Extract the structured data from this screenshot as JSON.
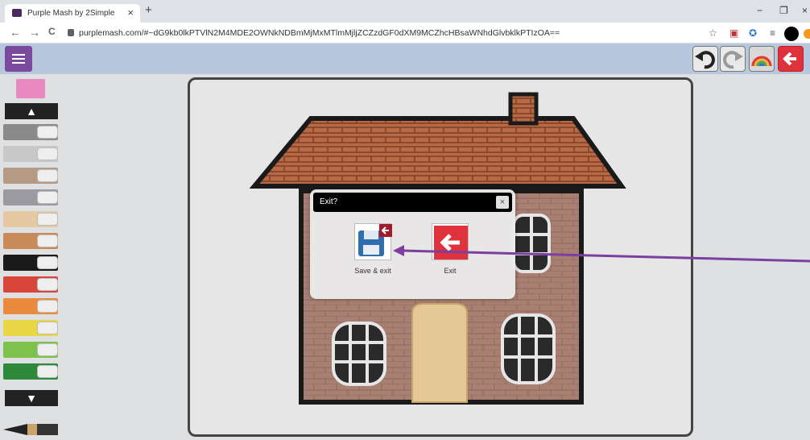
{
  "browser": {
    "tab_title": "Purple Mash by 2Simple",
    "tab_close": "×",
    "new_tab": "+",
    "url": "purplemash.com/#~dG9kb0lkPTVlN2M4MDE2OWNkNDBmMjMxMTlmMjljZCZzdGF0dXM9MCZhcHBsaWNhdGlvbklkPTIzOA==",
    "minimize": "−",
    "maximize": "❐",
    "close": "×",
    "back": "←",
    "forward": "→",
    "reload": "C"
  },
  "toolbar": {
    "undo_icon": "undo-icon",
    "redo_icon": "redo-icon",
    "rainbow_icon": "rainbow-icon",
    "exit_icon": "exit-arrow-icon",
    "accent": "#e0323c"
  },
  "sidebar": {
    "up_label": "▲",
    "down_label": "▼",
    "pens": [
      {
        "color": "#8a8a8a"
      },
      {
        "color": "#c8c8c8"
      },
      {
        "color": "#b59a86"
      },
      {
        "color": "#9a9aa0"
      },
      {
        "color": "#e6c9a2"
      },
      {
        "color": "#c98a5a"
      },
      {
        "color": "#1a1a1a"
      },
      {
        "color": "#d9453b"
      },
      {
        "color": "#ea8a3c"
      },
      {
        "color": "#e9d645"
      },
      {
        "color": "#7cc24b"
      },
      {
        "color": "#2e8a3a"
      }
    ]
  },
  "dialog": {
    "title": "Exit?",
    "close_label": "×",
    "save_exit_label": "Save & exit",
    "exit_label": "Exit"
  },
  "colors": {
    "topbar": "#b7c7dd",
    "menu": "#7a4a9c",
    "annotation_arrow": "#7b3fa0"
  }
}
